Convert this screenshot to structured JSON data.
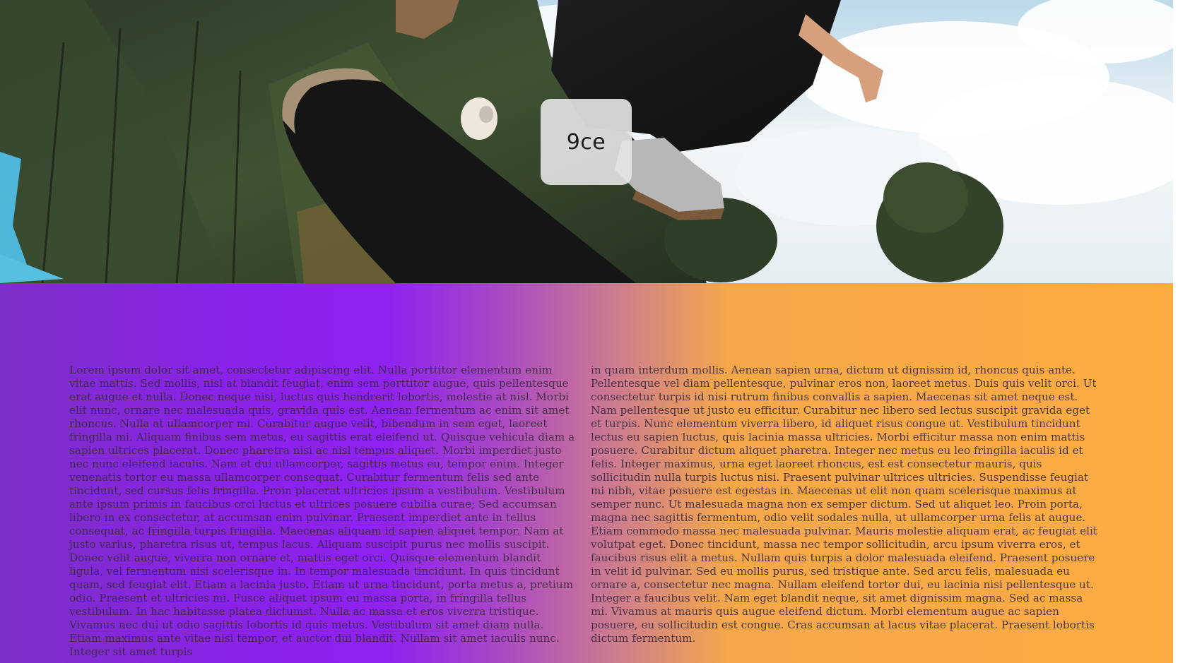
{
  "hero": {
    "image_alt": "skateboarder jumping over trees",
    "badge_text": "9ce"
  },
  "content": {
    "column_left": "Lorem ipsum dolor sit amet, consectetur adipiscing elit. Nulla porttitor elementum enim vitae mattis. Sed mollis, nisl at blandit feugiat, enim sem porttitor augue, quis pellentesque erat augue et nulla. Donec neque nisi, luctus quis hendrerit lobortis, molestie at nisl. Morbi elit nunc, ornare nec malesuada quis, gravida quis est. Aenean fermentum ac enim sit amet rhoncus. Nulla at ullamcorper mi. Curabitur augue velit, bibendum in sem eget, laoreet fringilla mi. Aliquam finibus sem metus, eu sagittis erat eleifend ut. Quisque vehicula diam a sapien ultrices placerat. Donec pharetra nisi ac nisl tempus aliquet. Morbi imperdiet justo nec nunc eleifend iaculis. Nam et dui ullamcorper, sagittis metus eu, tempor enim. Integer venenatis tortor eu massa ullamcorper consequat. Curabitur fermentum felis sed ante tincidunt, sed cursus felis fringilla. Proin placerat ultricies ipsum a vestibulum. Vestibulum ante ipsum primis in faucibus orci luctus et ultrices posuere cubilia curae; Sed accumsan libero in ex consectetur, at accumsan enim pulvinar. Praesent imperdiet ante in tellus consequat, ac fringilla turpis fringilla. Maecenas aliquam id sapien aliquet tempor. Nam at justo varius, pharetra risus ut, tempus lacus. Aliquam suscipit purus nec mollis suscipit. Donec velit augue, viverra non ornare et, mattis eget orci. Quisque elementum blandit ligula, vel fermentum nisi scelerisque in. In tempor malesuada tincidunt. In quis tincidunt quam, sed feugiat elit. Etiam a lacinia justo. Etiam ut urna tincidunt, porta metus a, pretium odio. Praesent et ultricies mi. Fusce aliquet ipsum eu massa porta, in fringilla tellus vestibulum. In hac habitasse platea dictumst. Nulla ac massa et eros viverra tristique. Vivamus nec dui ut odio sagittis lobortis id quis metus. Vestibulum sit amet diam nulla. Etiam maximus ante vitae nisi tempor, et auctor dui blandit. Nullam sit amet iaculis nunc. Integer sit amet turpis",
    "column_right": "in quam interdum mollis. Aenean sapien urna, dictum ut dignissim id, rhoncus quis ante. Pellentesque vel diam pellentesque, pulvinar eros non, laoreet metus. Duis quis velit orci. Ut consectetur turpis id nisi rutrum finibus convallis a sapien. Maecenas sit amet neque est. Nam pellentesque ut justo eu efficitur. Curabitur nec libero sed lectus suscipit gravida eget et turpis. Nunc elementum viverra libero, id aliquet risus congue ut. Vestibulum tincidunt lectus eu sapien luctus, quis lacinia massa ultricies. Morbi efficitur massa non enim mattis posuere. Curabitur dictum aliquet pharetra. Integer nec metus eu leo fringilla iaculis id et felis. Integer maximus, urna eget laoreet rhoncus, est est consectetur mauris, quis sollicitudin nulla turpis luctus nisi. Praesent pulvinar ultrices ultricies. Suspendisse feugiat mi nibh, vitae posuere est egestas in. Maecenas ut elit non quam scelerisque maximus at semper nunc. Ut malesuada magna non ex semper dictum. Sed ut aliquet leo. Proin porta, magna nec sagittis fermentum, odio velit sodales nulla, ut ullamcorper urna felis at augue. Etiam commodo massa nec malesuada pulvinar. Mauris molestie aliquam erat, ac feugiat elit volutpat eget. Donec tincidunt, massa nec tempor sollicitudin, arcu ipsum viverra eros, et faucibus risus elit a metus. Nullam quis turpis a dolor malesuada eleifend. Praesent posuere in velit id pulvinar. Sed eu mollis purus, sed tristique ante. Sed arcu felis, malesuada eu ornare a, consectetur nec magna. Nullam eleifend tortor dui, eu lacinia nisi pellentesque ut. Integer a faucibus velit. Nam eget blandit neque, sit amet dignissim magna. Sed ac massa mi. Vivamus at mauris quis augue eleifend dictum. Morbi elementum augue ac sapien posuere, eu sollicitudin est congue. Cras accumsan at lacus vitae placerat. Praesent lobortis dictum fermentum."
  },
  "colors": {
    "gradient_start": "#7c2fc6",
    "gradient_purple": "#8f22f0",
    "gradient_orange": "#fdac42",
    "text": "#3a2a3f"
  }
}
